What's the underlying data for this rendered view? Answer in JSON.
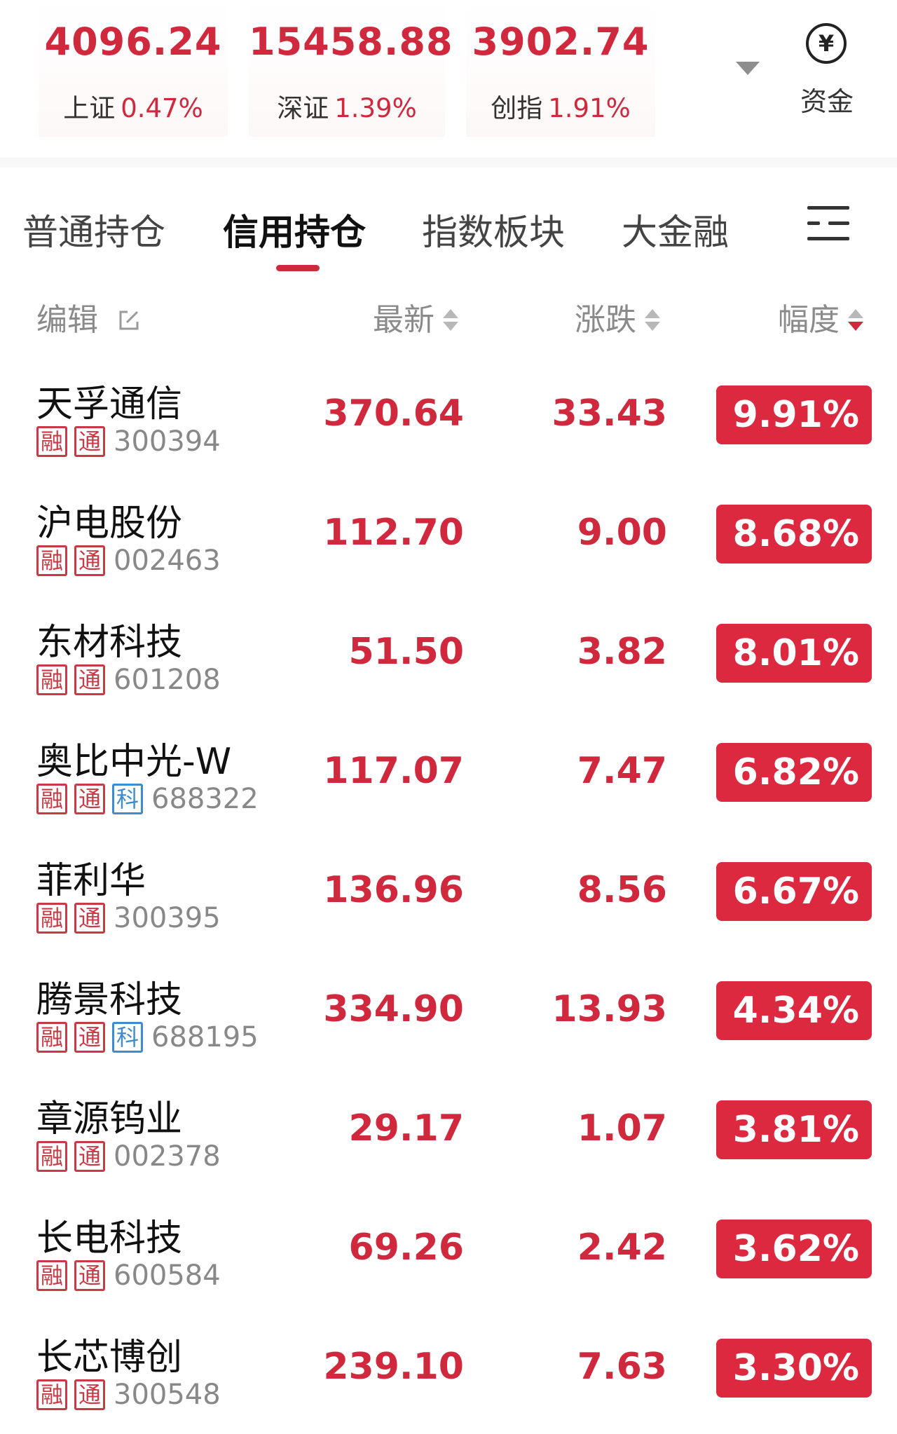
{
  "indices": [
    {
      "value": "4096.24",
      "name": "上证",
      "pct": "0.47%"
    },
    {
      "value": "15458.88",
      "name": "深证",
      "pct": "1.39%"
    },
    {
      "value": "3902.74",
      "name": "创指",
      "pct": "1.91%"
    }
  ],
  "fund": {
    "icon": "yen-icon",
    "icon_glyph": "¥",
    "label": "资金"
  },
  "tabs": [
    {
      "label": "普通持仓"
    },
    {
      "label": "信用持仓"
    },
    {
      "label": "指数板块"
    },
    {
      "label": "大金融"
    }
  ],
  "active_tab": "信用持仓",
  "columns": {
    "edit": "编辑",
    "latest": "最新",
    "change": "涨跌",
    "pct": "幅度"
  },
  "stocks": [
    {
      "name": "天孚通信",
      "tags": [
        "融",
        "通"
      ],
      "code": "300394",
      "latest": "370.64",
      "change": "33.43",
      "pct": "9.91%"
    },
    {
      "name": "沪电股份",
      "tags": [
        "融",
        "通"
      ],
      "code": "002463",
      "latest": "112.70",
      "change": "9.00",
      "pct": "8.68%"
    },
    {
      "name": "东材科技",
      "tags": [
        "融",
        "通"
      ],
      "code": "601208",
      "latest": "51.50",
      "change": "3.82",
      "pct": "8.01%"
    },
    {
      "name": "奥比中光-W",
      "tags": [
        "融",
        "通",
        "科"
      ],
      "code": "688322",
      "latest": "117.07",
      "change": "7.47",
      "pct": "6.82%"
    },
    {
      "name": "菲利华",
      "tags": [
        "融",
        "通"
      ],
      "code": "300395",
      "latest": "136.96",
      "change": "8.56",
      "pct": "6.67%"
    },
    {
      "name": "腾景科技",
      "tags": [
        "融",
        "通",
        "科"
      ],
      "code": "688195",
      "latest": "334.90",
      "change": "13.93",
      "pct": "4.34%"
    },
    {
      "name": "章源钨业",
      "tags": [
        "融",
        "通"
      ],
      "code": "002378",
      "latest": "29.17",
      "change": "1.07",
      "pct": "3.81%"
    },
    {
      "name": "长电科技",
      "tags": [
        "融",
        "通"
      ],
      "code": "600584",
      "latest": "69.26",
      "change": "2.42",
      "pct": "3.62%"
    },
    {
      "name": "长芯博创",
      "tags": [
        "融",
        "通"
      ],
      "code": "300548",
      "latest": "239.10",
      "change": "7.63",
      "pct": "3.30%"
    }
  ],
  "colors": {
    "up": "#d0283c",
    "tag_red": "#c83a45",
    "tag_blue": "#3c8ccf"
  }
}
